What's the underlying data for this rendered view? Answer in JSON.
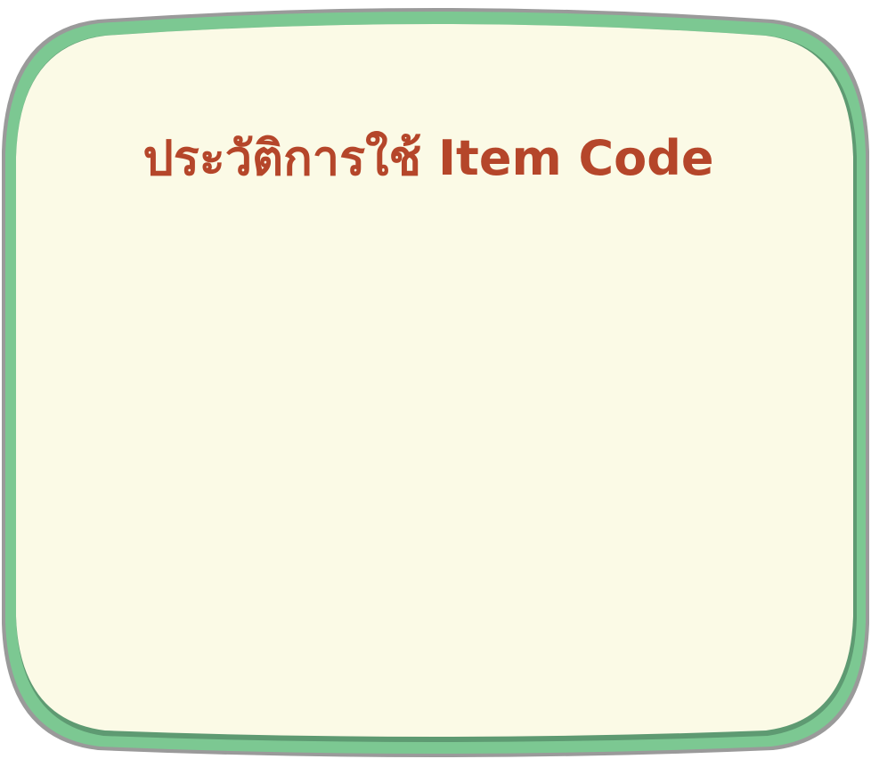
{
  "card": {
    "title": "ประวัติการใช้ Item Code",
    "colors": {
      "background": "#fbfae6",
      "border": "#7cc892",
      "border_dark": "#5e9a72",
      "outline": "#9a9a9a",
      "title": "#b5462a"
    }
  }
}
